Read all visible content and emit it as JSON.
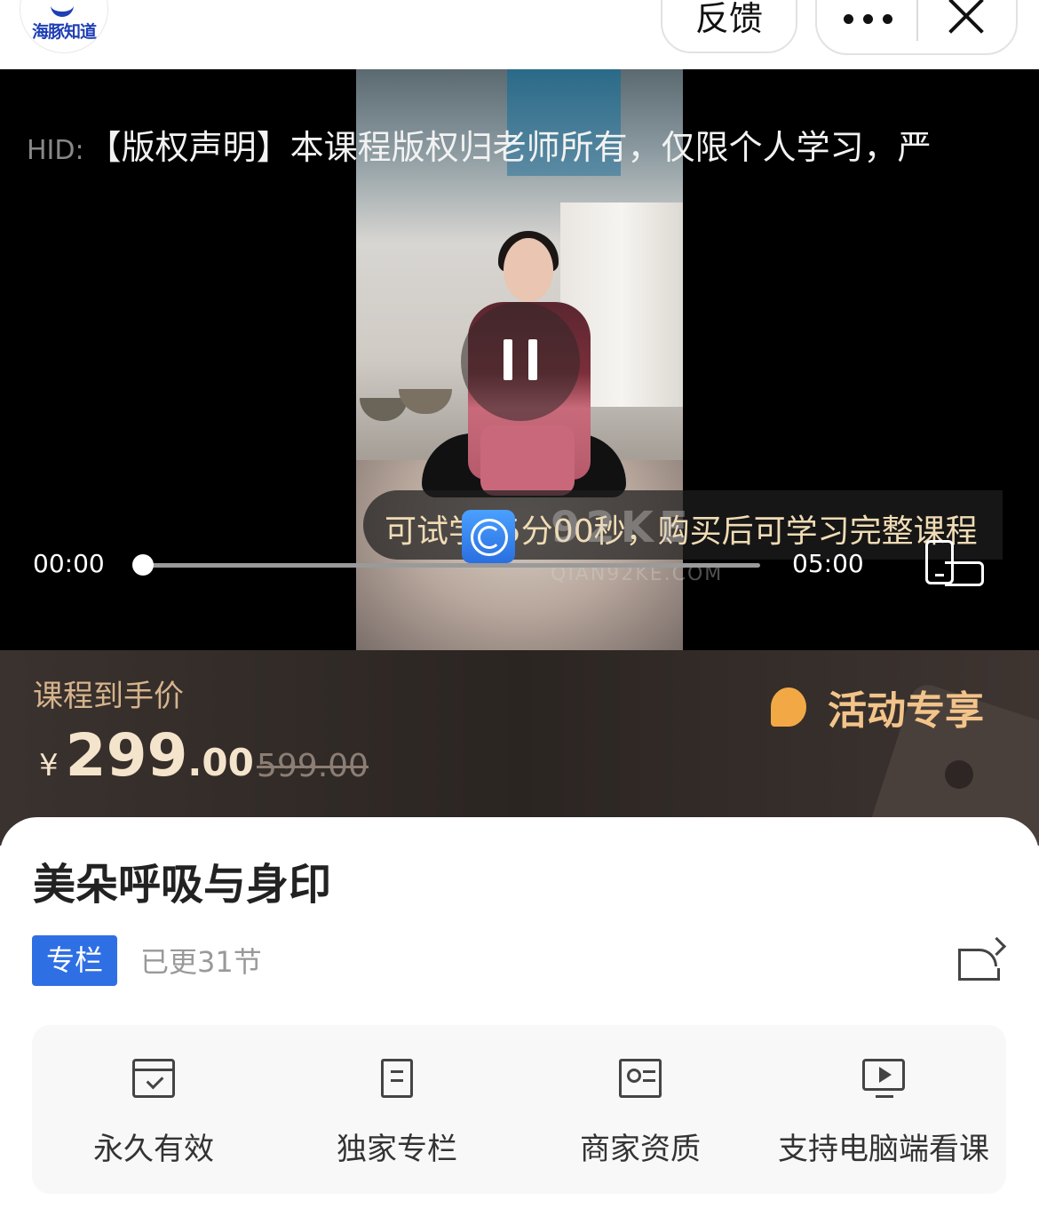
{
  "header": {
    "logo_text": "海豚知道",
    "feedback_label": "反馈",
    "more_icon": "more-dots-icon",
    "close_icon": "close-icon"
  },
  "video": {
    "watermark_hid": "HID:",
    "watermark_text": "【版权声明】本课程版权归老师所有，仅限个人学习，严",
    "trial_notice": "可试学05分00秒，购买后可学习完整课程",
    "current_time": "00:00",
    "total_time": "05:00",
    "progress_fraction": 0,
    "overlay_watermark": "92KE",
    "overlay_watermark_sub": "QIAN92KE.COM",
    "pause_icon": "pause-icon",
    "orientation_icon": "rotate-screen-icon"
  },
  "price": {
    "label": "课程到手价",
    "currency": "¥",
    "integer": "299",
    "decimal": ".00",
    "original": "599.00",
    "promo_label": "活动专享"
  },
  "course": {
    "title": "美朵呼吸与身印",
    "badge": "专栏",
    "updated": "已更31节",
    "share_icon": "share-icon"
  },
  "features": [
    {
      "label": "永久有效",
      "icon": "calendar-check-icon"
    },
    {
      "label": "独家专栏",
      "icon": "document-icon"
    },
    {
      "label": "商家资质",
      "icon": "id-card-icon"
    },
    {
      "label": "支持电脑端看课",
      "icon": "monitor-play-icon"
    }
  ],
  "colors": {
    "accent_blue": "#2f6fe4",
    "price_gold": "#f5e4cc",
    "label_gold": "#d6b48c",
    "promo_orange": "#f2a945",
    "banner_bg": "#2b2522"
  }
}
